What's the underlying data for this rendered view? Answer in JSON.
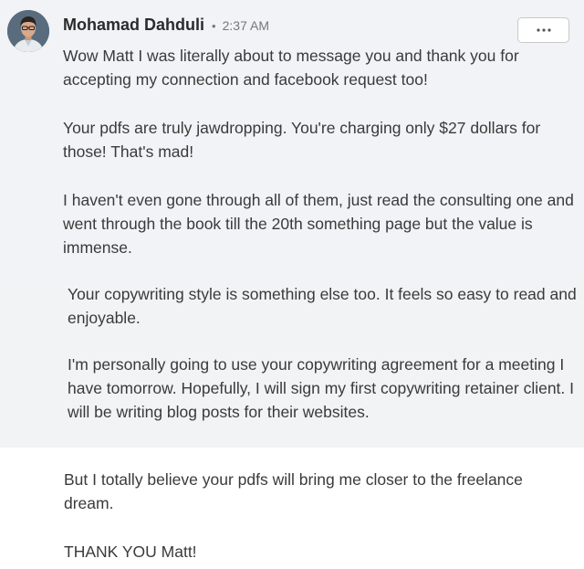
{
  "comment": {
    "author": "Mohamad Dahduli",
    "separator": "•",
    "time": "2:37 AM",
    "menu_icon": "ellipsis-icon",
    "paragraphs": [
      "Wow Matt I was literally about to message you and thank you for accepting my connection and facebook request too!",
      "Your pdfs are truly jawdropping. You're charging only $27 dollars for those! That's mad!",
      "I haven't even gone through all of them, just read the consulting one and went through the book till the 20th something page but the value is immense."
    ]
  },
  "continuation": {
    "paragraphs": [
      "Your copywriting style is something else too. It feels so easy to read and enjoyable.",
      "I'm personally going to use your copywriting agreement for a meeting I have tomorrow. Hopefully, I will sign my first copywriting retainer client. I will be writing blog posts for their websites."
    ]
  },
  "closing": {
    "paragraphs": [
      "But I totally believe your pdfs will bring me closer to the freelance dream.",
      "THANK YOU Matt!"
    ]
  }
}
